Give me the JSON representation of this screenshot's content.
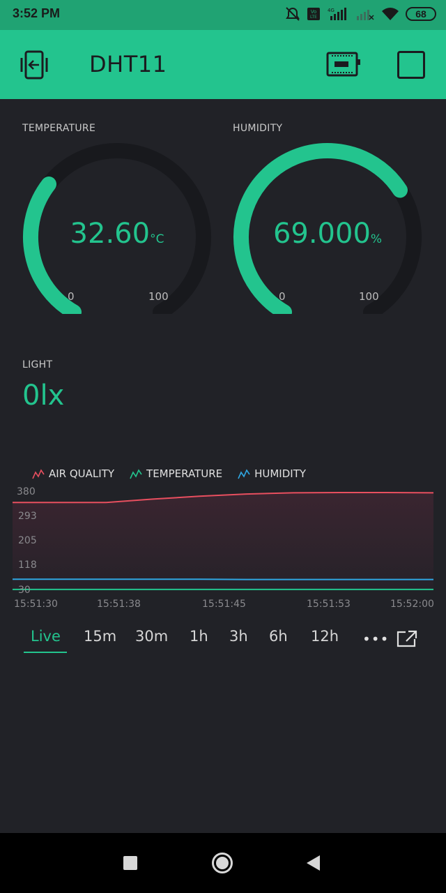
{
  "status_bar": {
    "time": "3:52 PM",
    "battery": "68",
    "icons": [
      "mute-icon",
      "volte-icon",
      "signal-4g-icon",
      "signal-weak-icon",
      "wifi-icon",
      "battery-icon"
    ]
  },
  "app_bar": {
    "title": "DHT11",
    "icons": [
      "back-to-project-icon",
      "device-board-icon",
      "stop-icon"
    ],
    "background": "#23c48e"
  },
  "gauges": [
    {
      "label": "TEMPERATURE",
      "value": "32.60",
      "unit": "°C",
      "min": "0",
      "max": "100",
      "level": 0.326
    },
    {
      "label": "HUMIDITY",
      "value": "69.000",
      "unit": "%",
      "min": "0",
      "max": "100",
      "level": 0.69
    }
  ],
  "light": {
    "label": "LIGHT",
    "value": "0lx"
  },
  "chart": {
    "legend": [
      {
        "name": "AIR QUALITY",
        "color": "#e84f5f"
      },
      {
        "name": "TEMPERATURE",
        "color": "#23c48e"
      },
      {
        "name": "HUMIDITY",
        "color": "#2fa7e3"
      }
    ],
    "y_ticks": [
      "380",
      "293",
      "205",
      "118",
      "30"
    ],
    "x_ticks": [
      "15:51:30",
      "15:51:38",
      "15:51:45",
      "15:51:53",
      "15:52:00"
    ]
  },
  "chart_data": {
    "type": "area",
    "x": [
      "15:51:30",
      "15:51:33",
      "15:51:35",
      "15:51:38",
      "15:51:41",
      "15:51:45",
      "15:51:49",
      "15:51:53",
      "15:51:56",
      "15:52:00"
    ],
    "series": [
      {
        "name": "AIR QUALITY",
        "values": [
          340,
          340,
          340,
          352,
          362,
          370,
          374,
          375,
          375,
          374
        ]
      },
      {
        "name": "TEMPERATURE",
        "values": [
          32.6,
          32.6,
          32.6,
          32.6,
          32.6,
          32.6,
          32.6,
          32.6,
          32.6,
          32.6
        ]
      },
      {
        "name": "HUMIDITY",
        "values": [
          69,
          69,
          69,
          69,
          69,
          68,
          68,
          68,
          68,
          68
        ]
      }
    ],
    "ylim": [
      30,
      380
    ],
    "grid": false,
    "legend": "top-left"
  },
  "periods": {
    "items": [
      "Live",
      "15m",
      "30m",
      "1h",
      "3h",
      "6h",
      "12h"
    ],
    "selected": "Live",
    "more": "•••"
  },
  "nav_bar": {
    "icons": [
      "recents-icon",
      "home-icon",
      "back-icon"
    ]
  }
}
